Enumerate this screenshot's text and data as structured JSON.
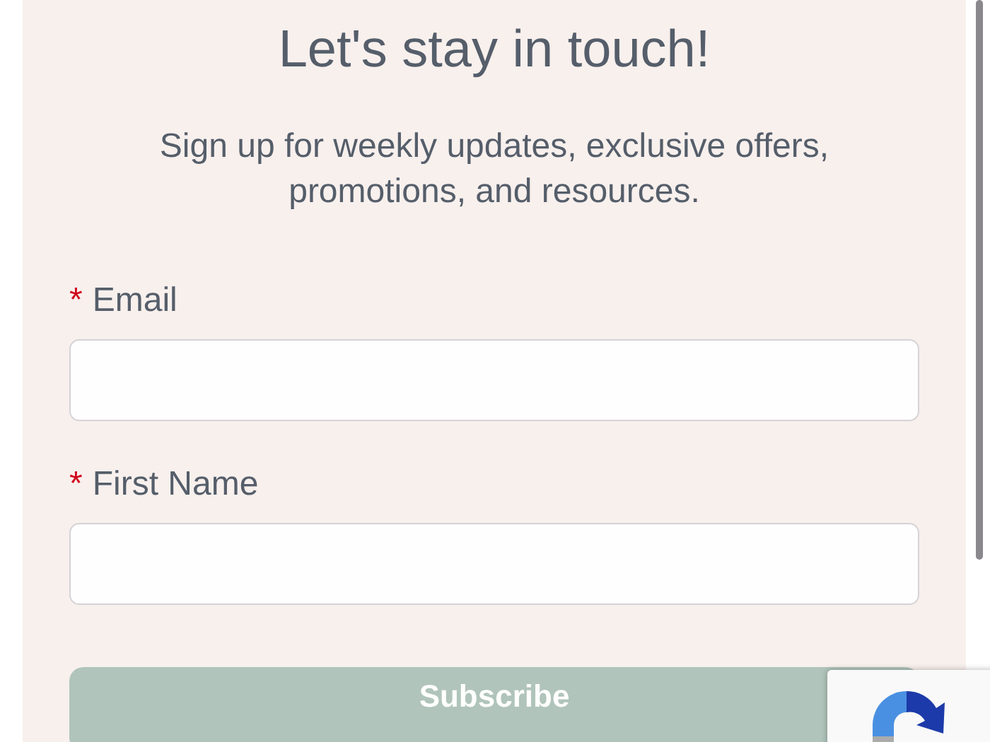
{
  "title": "Let's stay in touch!",
  "subtitle": "Sign up for weekly updates, exclusive offers, promotions, and resources.",
  "fields": [
    {
      "required_mark": "*",
      "label": "Email"
    },
    {
      "required_mark": "*",
      "label": "First Name"
    }
  ],
  "button": "Subscribe"
}
